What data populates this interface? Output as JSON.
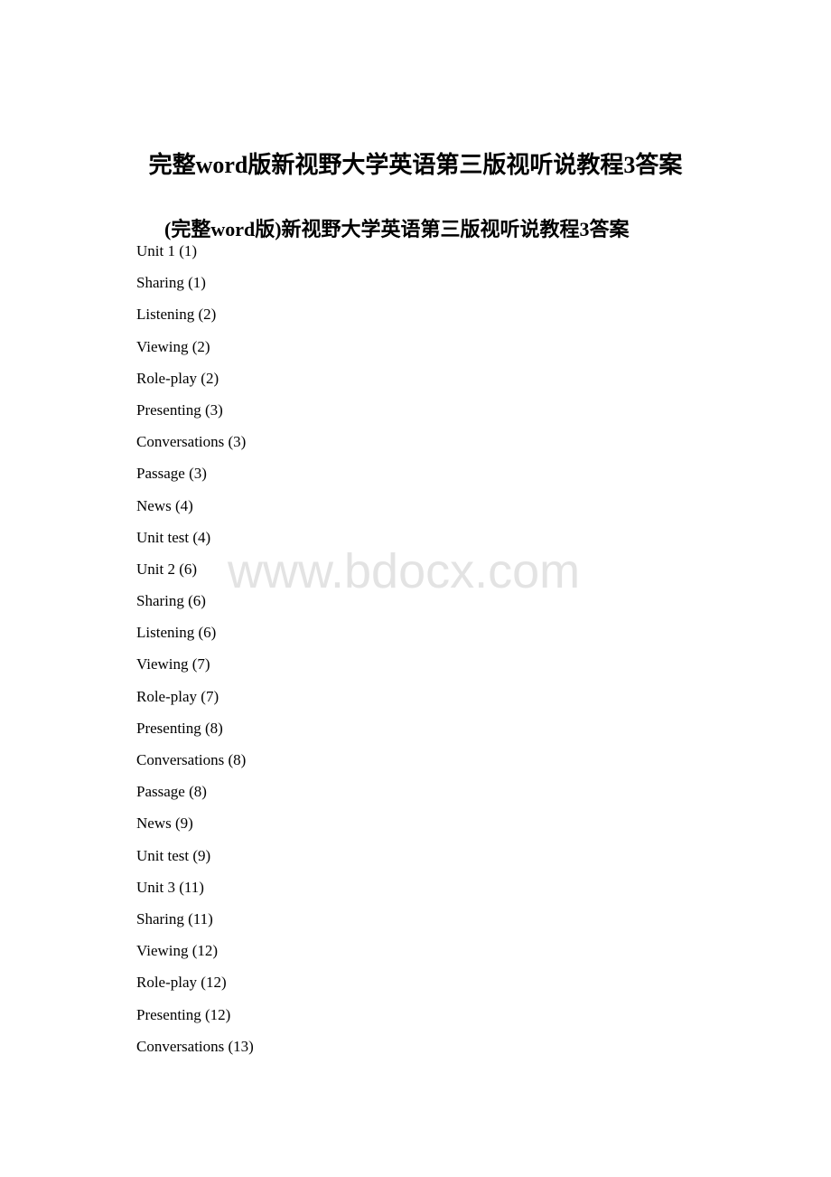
{
  "document": {
    "title": "完整word版新视野大学英语第三版视听说教程3答案",
    "subtitle": "(完整word版)新视野大学英语第三版视听说教程3答案",
    "watermark": "www.bdocx.com",
    "toc": [
      {
        "label": "Unit 1 (1)"
      },
      {
        "label": "Sharing (1)"
      },
      {
        "label": "Listening (2)"
      },
      {
        "label": "Viewing (2)"
      },
      {
        "label": "Role-play (2)"
      },
      {
        "label": "Presenting (3)"
      },
      {
        "label": "Conversations (3)"
      },
      {
        "label": "Passage (3)"
      },
      {
        "label": "News (4)"
      },
      {
        "label": "Unit test (4)"
      },
      {
        "label": "Unit 2 (6)"
      },
      {
        "label": "Sharing (6)"
      },
      {
        "label": "Listening (6)"
      },
      {
        "label": "Viewing (7)"
      },
      {
        "label": "Role-play (7)"
      },
      {
        "label": "Presenting (8)"
      },
      {
        "label": "Conversations (8)"
      },
      {
        "label": "Passage (8)"
      },
      {
        "label": "News (9)"
      },
      {
        "label": "Unit test (9)"
      },
      {
        "label": "Unit 3 (11)"
      },
      {
        "label": "Sharing (11)"
      },
      {
        "label": "Viewing (12)"
      },
      {
        "label": "Role-play (12)"
      },
      {
        "label": "Presenting (12)"
      },
      {
        "label": "Conversations (13)"
      }
    ]
  }
}
